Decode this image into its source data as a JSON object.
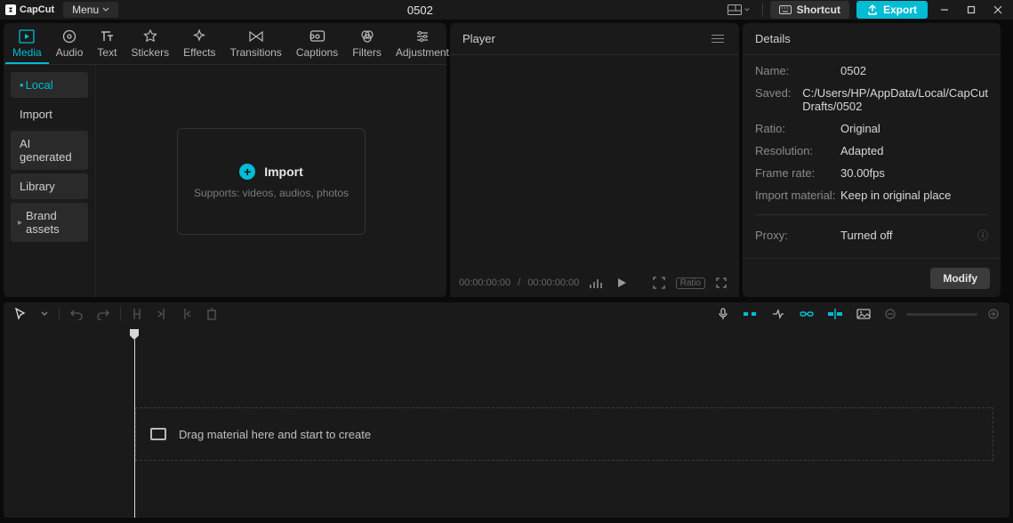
{
  "app": {
    "name": "CapCut",
    "project_title": "0502"
  },
  "titlebar": {
    "menu_label": "Menu",
    "shortcut_label": "Shortcut",
    "export_label": "Export"
  },
  "media_tabs": [
    {
      "id": "media",
      "label": "Media",
      "active": true
    },
    {
      "id": "audio",
      "label": "Audio",
      "active": false
    },
    {
      "id": "text",
      "label": "Text",
      "active": false
    },
    {
      "id": "stickers",
      "label": "Stickers",
      "active": false
    },
    {
      "id": "effects",
      "label": "Effects",
      "active": false
    },
    {
      "id": "transitions",
      "label": "Transitions",
      "active": false
    },
    {
      "id": "captions",
      "label": "Captions",
      "active": false
    },
    {
      "id": "filters",
      "label": "Filters",
      "active": false
    },
    {
      "id": "adjustment",
      "label": "Adjustment",
      "active": false
    }
  ],
  "media_sidebar": {
    "local": "Local",
    "import": "Import",
    "ai": "AI generated",
    "library": "Library",
    "brand": "Brand assets"
  },
  "import_box": {
    "label": "Import",
    "subtext": "Supports: videos, audios, photos"
  },
  "player": {
    "title": "Player",
    "time_current": "00:00:00:00",
    "time_total": "00:00:00:00",
    "ratio_label": "Ratio"
  },
  "details": {
    "title": "Details",
    "name_label": "Name:",
    "name_value": "0502",
    "saved_label": "Saved:",
    "saved_value": "C:/Users/HP/AppData/Local/CapCut Drafts/0502",
    "ratio_label": "Ratio:",
    "ratio_value": "Original",
    "resolution_label": "Resolution:",
    "resolution_value": "Adapted",
    "framerate_label": "Frame rate:",
    "framerate_value": "30.00fps",
    "material_label": "Import material:",
    "material_value": "Keep in original place",
    "proxy_label": "Proxy:",
    "proxy_value": "Turned off",
    "modify_label": "Modify"
  },
  "timeline": {
    "drop_hint": "Drag material here and start to create"
  }
}
